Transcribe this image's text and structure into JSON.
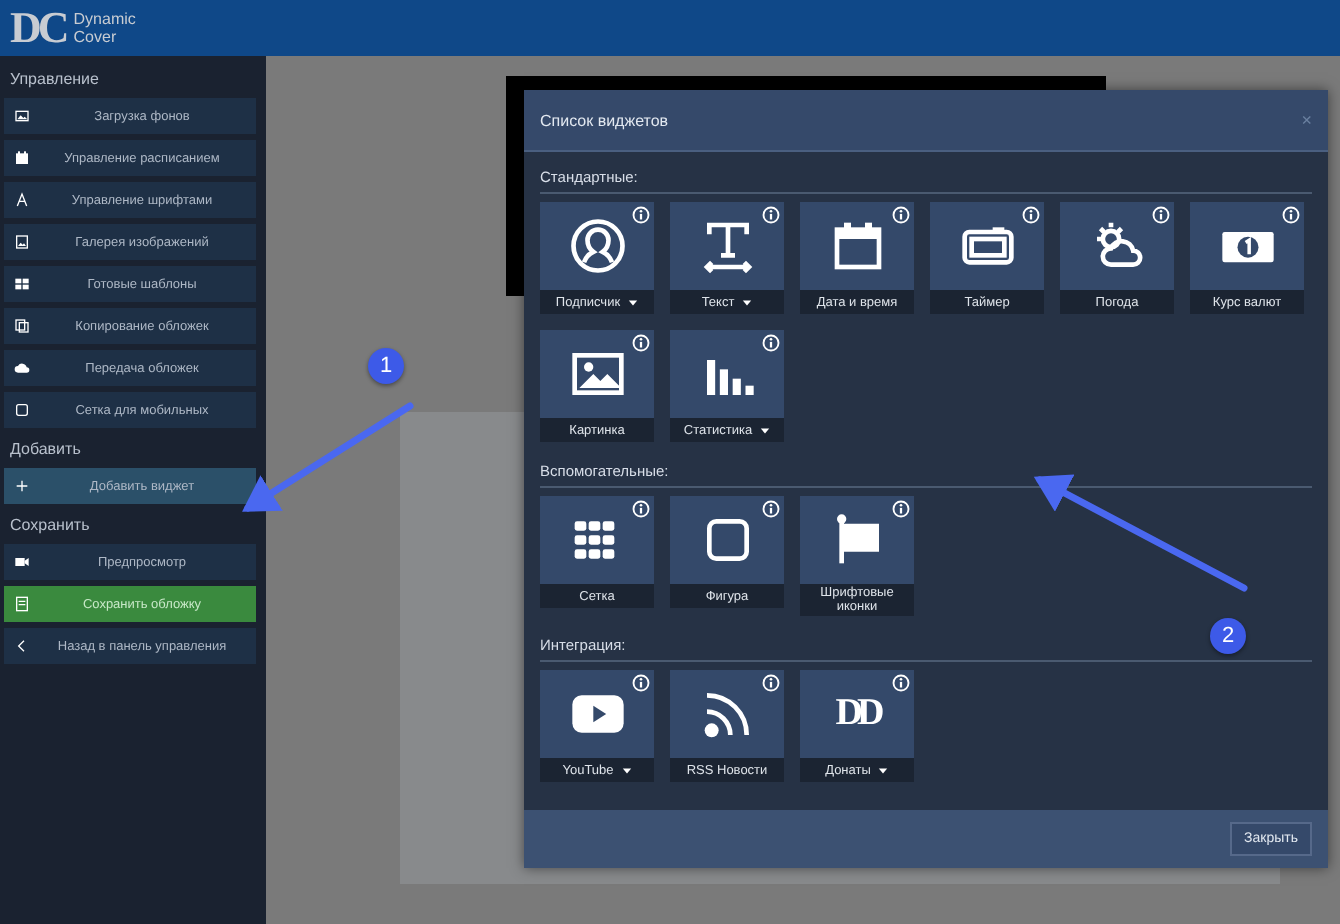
{
  "header": {
    "logo_mark": "DC",
    "logo_lines": [
      "Dynamic",
      "Cover"
    ]
  },
  "sidebar": {
    "sections": [
      {
        "title": "Управление",
        "items": [
          {
            "label": "Загрузка фонов",
            "kind": "normal"
          },
          {
            "label": "Управление расписанием",
            "kind": "normal"
          },
          {
            "label": "Управление шрифтами",
            "kind": "normal"
          },
          {
            "label": "Галерея изображений",
            "kind": "normal"
          },
          {
            "label": "Готовые шаблоны",
            "kind": "normal"
          },
          {
            "label": "Копирование обложек",
            "kind": "normal"
          },
          {
            "label": "Передача обложек",
            "kind": "normal"
          },
          {
            "label": "Сетка для мобильных",
            "kind": "normal"
          }
        ]
      },
      {
        "title": "Добавить",
        "items": [
          {
            "label": "Добавить виджет",
            "kind": "active"
          }
        ]
      },
      {
        "title": "Сохранить",
        "items": [
          {
            "label": "Предпросмотр",
            "kind": "normal"
          },
          {
            "label": "Сохранить обложку",
            "kind": "success"
          },
          {
            "label": "Назад в панель управления",
            "kind": "normal"
          }
        ]
      }
    ]
  },
  "modal": {
    "title": "Список виджетов",
    "close": "×",
    "sections": [
      {
        "title": "Стандартные:",
        "widgets": [
          {
            "label": "Подписчик",
            "dropdown": true
          },
          {
            "label": "Текст",
            "dropdown": true
          },
          {
            "label": "Дата и время",
            "dropdown": false
          },
          {
            "label": "Таймер",
            "dropdown": false
          },
          {
            "label": "Погода",
            "dropdown": false
          },
          {
            "label": "Курс валют",
            "dropdown": false
          },
          {
            "label": "Картинка",
            "dropdown": false
          },
          {
            "label": "Статистика",
            "dropdown": true
          }
        ]
      },
      {
        "title": "Вспомогательные:",
        "widgets": [
          {
            "label": "Сетка",
            "dropdown": false
          },
          {
            "label": "Фигура",
            "dropdown": false
          },
          {
            "label": "Шрифтовые иконки",
            "dropdown": false
          }
        ]
      },
      {
        "title": "Интеграция:",
        "widgets": [
          {
            "label": "YouTube",
            "dropdown": true
          },
          {
            "label": "RSS Новости",
            "dropdown": false
          },
          {
            "label": "Донаты",
            "logo_text": "DD",
            "dropdown": true
          }
        ]
      }
    ],
    "footer_button": "Закрыть"
  },
  "annotations": [
    {
      "label": "1"
    },
    {
      "label": "2"
    }
  ]
}
